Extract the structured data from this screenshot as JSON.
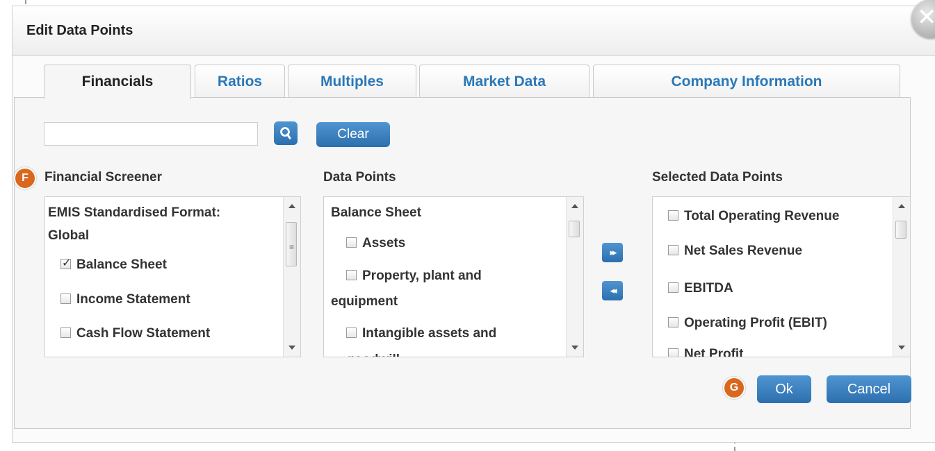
{
  "dialog": {
    "title": "Edit Data Points"
  },
  "tabs": [
    {
      "label": "Financials",
      "active": true
    },
    {
      "label": "Ratios"
    },
    {
      "label": "Multiples"
    },
    {
      "label": "Market Data"
    },
    {
      "label": "Company Information"
    }
  ],
  "search": {
    "value": "",
    "clear_label": "Clear"
  },
  "financial_screener": {
    "label": "Financial Screener",
    "items": [
      {
        "label": "EMIS Standardised Format:"
      },
      {
        "label": "Global"
      },
      {
        "label": "Balance Sheet",
        "checked": true
      },
      {
        "label": "Income Statement",
        "checked": false
      },
      {
        "label": "Cash Flow Statement",
        "checked": false
      }
    ]
  },
  "data_points": {
    "label": "Data Points",
    "items": [
      {
        "label": "Balance Sheet"
      },
      {
        "label": "Assets",
        "checked": false
      },
      {
        "label": "Property, plant and",
        "checked": false
      },
      {
        "label": "equipment"
      },
      {
        "label": "Intangible assets and",
        "checked": false
      },
      {
        "label": "goodwill",
        "checked": false
      }
    ]
  },
  "selected_data_points": {
    "label": "Selected Data Points",
    "items": [
      {
        "label": "Total Operating Revenue",
        "checked": false
      },
      {
        "label": "Net Sales Revenue",
        "checked": false
      },
      {
        "label": "EBITDA",
        "checked": false
      },
      {
        "label": "Operating Profit (EBIT)",
        "checked": false
      },
      {
        "label": "Net Profit",
        "checked": false
      }
    ]
  },
  "buttons": {
    "ok": "Ok",
    "cancel": "Cancel"
  },
  "markers": {
    "f": "F",
    "g": "G"
  },
  "colors": {
    "accent": "#2d6fae",
    "tab_text": "#2a78b8",
    "marker": "#d9681e"
  }
}
